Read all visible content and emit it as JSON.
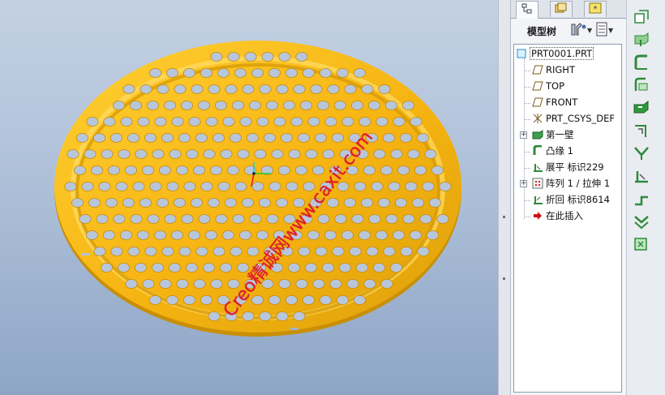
{
  "watermark": {
    "text": "Creo精诚网www.caxit.com",
    "color": "#e0202a"
  },
  "model": {
    "color": "#f2b418"
  },
  "panel": {
    "tabs": [
      {
        "name": "model-tree-tab",
        "icon": "tree-icon"
      },
      {
        "name": "folder-browser-tab",
        "icon": "folder-icon"
      },
      {
        "name": "favorites-tab",
        "icon": "favorites-icon"
      }
    ],
    "tree_title": "模型树",
    "settings_icon": "settings-icon",
    "show_icon": "show-icon"
  },
  "tree": {
    "root": {
      "label": "PRT0001.PRT",
      "icon": "part-icon"
    },
    "items": [
      {
        "label": "RIGHT",
        "icon": "datum-plane-icon"
      },
      {
        "label": "TOP",
        "icon": "datum-plane-icon"
      },
      {
        "label": "FRONT",
        "icon": "datum-plane-icon"
      },
      {
        "label": "PRT_CSYS_DEF",
        "icon": "csys-icon"
      },
      {
        "label": "第一壁",
        "icon": "first-wall-icon",
        "expandable": true
      },
      {
        "label": "凸缘 1",
        "icon": "flange-icon"
      },
      {
        "label": "展平 标识229",
        "icon": "unbend-icon"
      },
      {
        "label": "阵列 1 / 拉伸 1",
        "icon": "pattern-icon",
        "expandable": true
      },
      {
        "label": "折回 标识8614",
        "icon": "bendback-icon"
      },
      {
        "label": "在此插入",
        "icon": "insert-here-icon"
      }
    ]
  },
  "right_toolbar": [
    "convert-icon",
    "flat-wall-icon",
    "flange-wall-icon",
    "unattached-wall-icon",
    "extrude-cut-icon",
    "corner-relief-icon",
    "bend-icon",
    "unbend-icon",
    "bend-back-icon",
    "form-icon",
    "flatten-icon"
  ]
}
